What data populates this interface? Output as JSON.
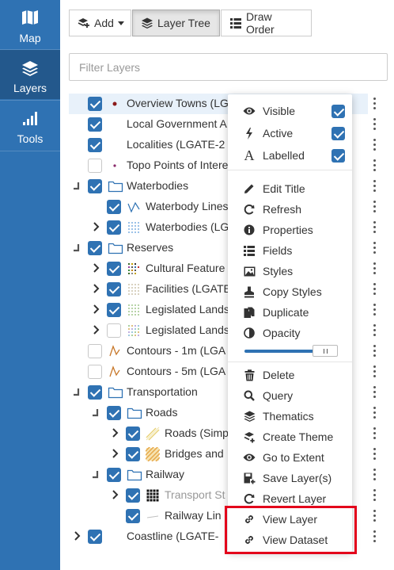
{
  "sidebar": {
    "items": [
      {
        "label": "Map",
        "icon": "map-icon",
        "active": false
      },
      {
        "label": "Layers",
        "icon": "layers-icon",
        "active": true
      },
      {
        "label": "Tools",
        "icon": "signal-bars-icon",
        "active": false
      }
    ]
  },
  "toolbar": {
    "add_label": "Add",
    "layer_tree_label": "Layer Tree",
    "draw_order_label": "Draw Order"
  },
  "filter": {
    "placeholder": "Filter Layers",
    "value": ""
  },
  "tree": [
    {
      "label": "Overview Towns (LG",
      "checked": true
    },
    {
      "label": "Local Government A",
      "checked": true
    },
    {
      "label": "Localities (LGATE-2",
      "checked": true
    },
    {
      "label": "Topo Points of Intere",
      "checked": false
    },
    {
      "label": "Waterbodies",
      "checked": true,
      "group": true
    },
    {
      "label": "Waterbody Lines",
      "checked": true
    },
    {
      "label": "Waterbodies (LG",
      "checked": true
    },
    {
      "label": "Reserves",
      "checked": true,
      "group": true
    },
    {
      "label": "Cultural Feature",
      "checked": true
    },
    {
      "label": "Facilities (LGATE",
      "checked": true
    },
    {
      "label": "Legislated Lands",
      "checked": true
    },
    {
      "label": "Legislated Lands",
      "checked": false
    },
    {
      "label": "Contours - 1m (LGA",
      "checked": false
    },
    {
      "label": "Contours - 5m (LGA",
      "checked": false
    },
    {
      "label": "Transportation",
      "checked": true,
      "group": true
    },
    {
      "label": "Roads",
      "checked": true,
      "group": true
    },
    {
      "label": "Roads (Simp",
      "checked": true
    },
    {
      "label": "Bridges and",
      "checked": true
    },
    {
      "label": "Railway",
      "checked": true,
      "group": true
    },
    {
      "label": "Transport St",
      "checked": true
    },
    {
      "label": "Railway Lin",
      "checked": true
    },
    {
      "label": "Coastline (LGATE-",
      "checked": true
    }
  ],
  "context_menu": {
    "toggles": [
      {
        "label": "Visible",
        "icon": "eye-icon",
        "checked": true
      },
      {
        "label": "Active",
        "icon": "bolt-icon",
        "checked": true
      },
      {
        "label": "Labelled",
        "icon": "font-icon",
        "checked": true
      }
    ],
    "items": [
      {
        "label": "Edit Title",
        "icon": "pencil-icon"
      },
      {
        "label": "Refresh",
        "icon": "refresh-icon"
      },
      {
        "label": "Properties",
        "icon": "info-icon"
      },
      {
        "label": "Fields",
        "icon": "list-icon"
      },
      {
        "label": "Styles",
        "icon": "image-icon"
      },
      {
        "label": "Copy Styles",
        "icon": "stamp-icon"
      },
      {
        "label": "Duplicate",
        "icon": "copy-icon"
      },
      {
        "label": "Opacity",
        "icon": "adjust-icon"
      }
    ],
    "opacity": 0.85,
    "items2": [
      {
        "label": "Delete",
        "icon": "trash-icon"
      },
      {
        "label": "Query",
        "icon": "search-icon"
      },
      {
        "label": "Thematics",
        "icon": "layers-icon"
      },
      {
        "label": "Create Theme",
        "icon": "create-theme-icon"
      },
      {
        "label": "Go to Extent",
        "icon": "eye-icon"
      },
      {
        "label": "Save Layer(s)",
        "icon": "save-icon"
      },
      {
        "label": "Revert Layer",
        "icon": "refresh-icon"
      },
      {
        "label": "View Layer",
        "icon": "link-icon"
      },
      {
        "label": "View Dataset",
        "icon": "link-icon"
      }
    ]
  },
  "colors": {
    "accent": "#2f72b3",
    "sidebar": "#2f72b3",
    "highlight": "#e3001b"
  }
}
